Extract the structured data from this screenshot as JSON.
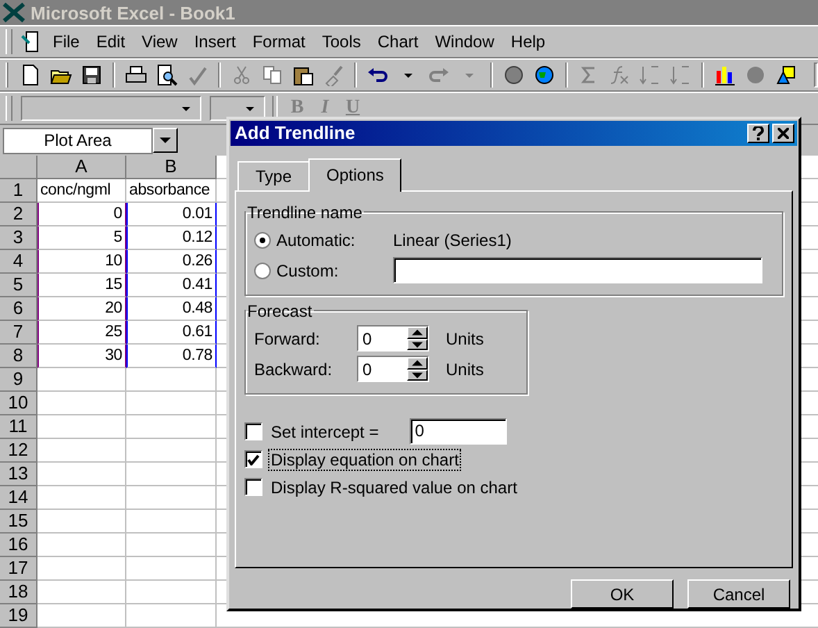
{
  "window": {
    "title": "Microsoft Excel - Book1"
  },
  "menu": [
    "File",
    "Edit",
    "View",
    "Insert",
    "Format",
    "Tools",
    "Chart",
    "Window",
    "Help"
  ],
  "format_toolbar": {
    "buttons": [
      "B",
      "I",
      "U"
    ]
  },
  "name_box": {
    "value": "Plot Area"
  },
  "sheet": {
    "columns": [
      {
        "label": "A",
        "color": "#800080"
      },
      {
        "label": "B",
        "color": "#0000ff"
      }
    ],
    "rows": [
      {
        "number": "1",
        "cells": [
          "conc/ngml",
          "absorbance"
        ],
        "in_range": false
      },
      {
        "number": "2",
        "cells": [
          "0",
          "0.01"
        ],
        "in_range": true
      },
      {
        "number": "3",
        "cells": [
          "5",
          "0.12"
        ],
        "in_range": true
      },
      {
        "number": "4",
        "cells": [
          "10",
          "0.26"
        ],
        "in_range": true
      },
      {
        "number": "5",
        "cells": [
          "15",
          "0.41"
        ],
        "in_range": true
      },
      {
        "number": "6",
        "cells": [
          "20",
          "0.48"
        ],
        "in_range": true
      },
      {
        "number": "7",
        "cells": [
          "25",
          "0.61"
        ],
        "in_range": true
      },
      {
        "number": "8",
        "cells": [
          "30",
          "0.78"
        ],
        "in_range": true
      },
      {
        "number": "9",
        "cells": [],
        "in_range": false
      },
      {
        "number": "10",
        "cells": [],
        "in_range": false
      },
      {
        "number": "11",
        "cells": [],
        "in_range": false
      },
      {
        "number": "12",
        "cells": [],
        "in_range": false
      },
      {
        "number": "13",
        "cells": [],
        "in_range": false
      },
      {
        "number": "14",
        "cells": [],
        "in_range": false
      },
      {
        "number": "15",
        "cells": [],
        "in_range": false
      },
      {
        "number": "16",
        "cells": [],
        "in_range": false
      },
      {
        "number": "17",
        "cells": [],
        "in_range": false
      },
      {
        "number": "18",
        "cells": [],
        "in_range": false
      },
      {
        "number": "19",
        "cells": [],
        "in_range": false
      }
    ]
  },
  "dialog": {
    "title": "Add Trendline",
    "tabs": [
      {
        "label": "Type",
        "selected": false
      },
      {
        "label": "Options",
        "selected": true
      }
    ],
    "trendline_name": {
      "legend": "Trendline name",
      "options": [
        {
          "label": "Automatic:",
          "selected": true,
          "kind": "text",
          "value": "Linear (Series1)"
        },
        {
          "label": "Custom:",
          "selected": false,
          "kind": "field"
        }
      ]
    },
    "forecast": {
      "legend": "Forecast",
      "fields": [
        {
          "label": "Forward:",
          "value": "0",
          "unit": "Units"
        },
        {
          "label": "Backward:",
          "value": "0",
          "unit": "Units"
        }
      ]
    },
    "checks": [
      {
        "label": "Set intercept =",
        "checked": false,
        "focused": false,
        "kind": "field",
        "value": "0"
      },
      {
        "label": "Display equation on chart",
        "checked": true,
        "focused": true,
        "kind": "plain"
      },
      {
        "label": "Display R-squared value on chart",
        "checked": false,
        "focused": false,
        "kind": "plain"
      }
    ],
    "buttons": [
      "OK",
      "Cancel"
    ]
  }
}
